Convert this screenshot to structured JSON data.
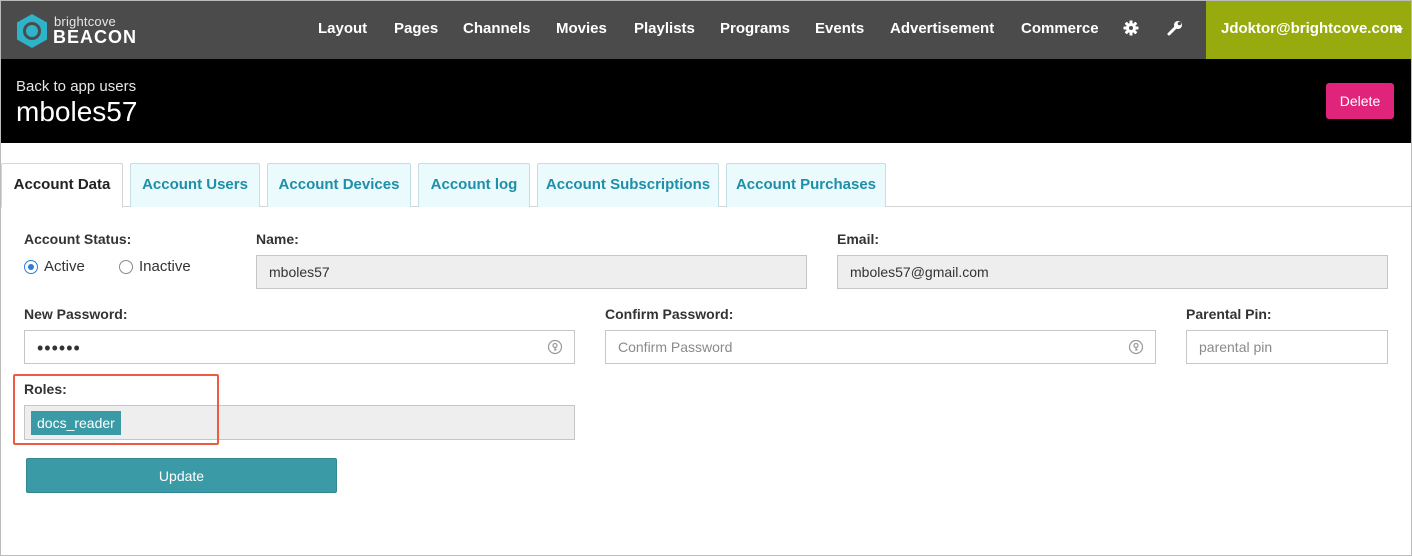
{
  "brand": {
    "small": "brightcove",
    "big": "BEACON"
  },
  "nav": {
    "items": [
      "Layout",
      "Pages",
      "Channels",
      "Movies",
      "Playlists",
      "Programs",
      "Events",
      "Advertisement",
      "Commerce"
    ],
    "settings_icon": "gear-icon",
    "tools_icon": "wrench-icon",
    "user": "Jdoktor@brightcove.com"
  },
  "header": {
    "back_link": "Back to app users",
    "title": "mboles57",
    "delete_label": "Delete"
  },
  "tabs": [
    {
      "label": "Account Data",
      "active": true
    },
    {
      "label": "Account Users",
      "active": false
    },
    {
      "label": "Account Devices",
      "active": false
    },
    {
      "label": "Account log",
      "active": false
    },
    {
      "label": "Account Subscriptions",
      "active": false
    },
    {
      "label": "Account Purchases",
      "active": false
    }
  ],
  "form": {
    "status": {
      "label": "Account Status:",
      "options": [
        "Active",
        "Inactive"
      ],
      "selected": "Active"
    },
    "name": {
      "label": "Name:",
      "value": "mboles57"
    },
    "email": {
      "label": "Email:",
      "value": "mboles57@gmail.com"
    },
    "new_password": {
      "label": "New Password:",
      "value": "••••••"
    },
    "confirm_password": {
      "label": "Confirm Password:",
      "placeholder": "Confirm Password"
    },
    "parental_pin": {
      "label": "Parental Pin:",
      "placeholder": "parental pin"
    },
    "roles": {
      "label": "Roles:",
      "tags": [
        "docs_reader"
      ]
    },
    "update_label": "Update"
  },
  "colors": {
    "nav_bg": "#4b4b4b",
    "user_menu_bg": "#97ab0f",
    "header_bg": "#000000",
    "delete_bg": "#e0247b",
    "accent_teal": "#3a9aa6",
    "tab_text": "#1d8fa8",
    "highlight": "#ef5a42"
  }
}
